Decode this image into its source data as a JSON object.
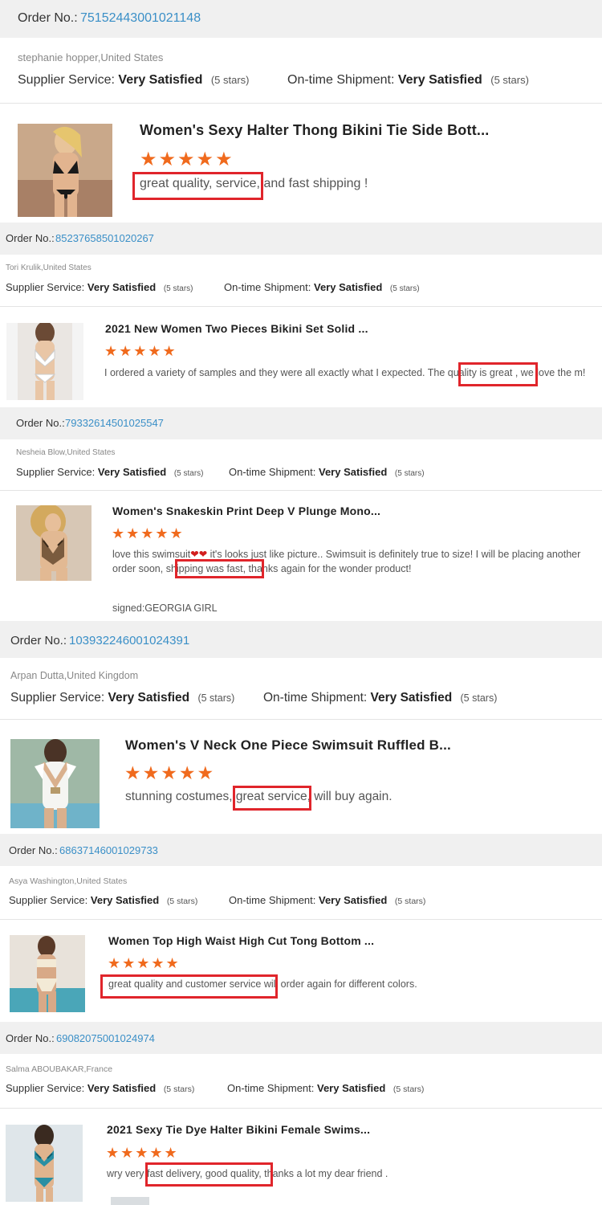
{
  "reviews": [
    {
      "order_label": "Order No.:",
      "order_no": "75152443001021148",
      "buyer": "stephanie hopper,United States",
      "supplier_label": "Supplier Service:",
      "supplier_value": "Very Satisfied",
      "supplier_stars": "(5 stars)",
      "shipment_label": "On-time Shipment:",
      "shipment_value": "Very Satisfied",
      "shipment_stars": "(5 stars)",
      "product_title": "Women's Sexy Halter Thong Bikini Tie Side Bott...",
      "rating": "★★★★★",
      "review_text": "great quality, service, and fast shipping !",
      "highlight": "great quality, service,"
    },
    {
      "order_label": "Order No.:",
      "order_no": "85237658501020267",
      "buyer": "Tori Krulik,United States",
      "supplier_label": "Supplier Service:",
      "supplier_value": "Very Satisfied",
      "supplier_stars": "(5 stars)",
      "shipment_label": "On-time Shipment:",
      "shipment_value": "Very Satisfied",
      "shipment_stars": "(5 stars)",
      "product_title": "2021 New Women Two Pieces Bikini Set Solid ...",
      "rating": "★★★★★",
      "review_text": "I ordered a variety of samples and they were all exactly what I expected. The quality is great , we love the m!",
      "highlight": "quality is great"
    },
    {
      "order_label": "Order No.:",
      "order_no": "79332614501025547",
      "buyer": "Nesheia Blow,United States",
      "supplier_label": "Supplier Service:",
      "supplier_value": "Very Satisfied",
      "supplier_stars": "(5 stars)",
      "shipment_label": "On-time Shipment:",
      "shipment_value": "Very Satisfied",
      "shipment_stars": "(5 stars)",
      "product_title": "Women's Snakeskin Print Deep V Plunge Mono...",
      "rating": "★★★★★",
      "review_text_a": "love this swimsuit",
      "review_hearts": "❤❤",
      "review_text_b": " it's looks just like picture.. Swimsuit is definitely true to size! I will be placing another order soon, shipping was fast, thanks again for the wonder product!",
      "highlight": "shipping was fast",
      "signed": "signed:GEORGIA GIRL"
    },
    {
      "order_label": "Order No.:",
      "order_no": "103932246001024391",
      "buyer": "Arpan Dutta,United Kingdom",
      "supplier_label": "Supplier Service:",
      "supplier_value": "Very Satisfied",
      "supplier_stars": "(5 stars)",
      "shipment_label": "On-time Shipment:",
      "shipment_value": "Very Satisfied",
      "shipment_stars": "(5 stars)",
      "product_title": "Women's V Neck One Piece Swimsuit Ruffled B...",
      "rating": "★★★★★",
      "review_text": "stunning costumes, great service, will buy again.",
      "highlight": "great service"
    },
    {
      "order_label": "Order No.:",
      "order_no": "68637146001029733",
      "buyer": "Asya Washington,United States",
      "supplier_label": "Supplier Service:",
      "supplier_value": "Very Satisfied",
      "supplier_stars": "(5 stars)",
      "shipment_label": "On-time Shipment:",
      "shipment_value": "Very Satisfied",
      "shipment_stars": "(5 stars)",
      "product_title": "Women Top High Waist High Cut Tong Bottom ...",
      "rating": "★★★★★",
      "review_text": "great quality and customer service will order again for different colors.",
      "highlight": "great quality and customer service"
    },
    {
      "order_label": "Order No.:",
      "order_no": "69082075001024974",
      "buyer": "Salma ABOUBAKAR,France",
      "supplier_label": "Supplier Service:",
      "supplier_value": "Very Satisfied",
      "supplier_stars": "(5 stars)",
      "shipment_label": "On-time Shipment:",
      "shipment_value": "Very Satisfied",
      "shipment_stars": "(5 stars)",
      "product_title": "2021 Sexy Tie Dye Halter Bikini Female Swims...",
      "rating": "★★★★★",
      "review_text": "wry very fast delivery, good quality, thanks a lot my dear friend .",
      "highlight": "fast delivery, good quality"
    }
  ],
  "colors": {
    "accent": "#f06a1d",
    "link": "#3a8fc7",
    "highlight_box": "#e0252b",
    "bar": "#f0f0f0"
  }
}
